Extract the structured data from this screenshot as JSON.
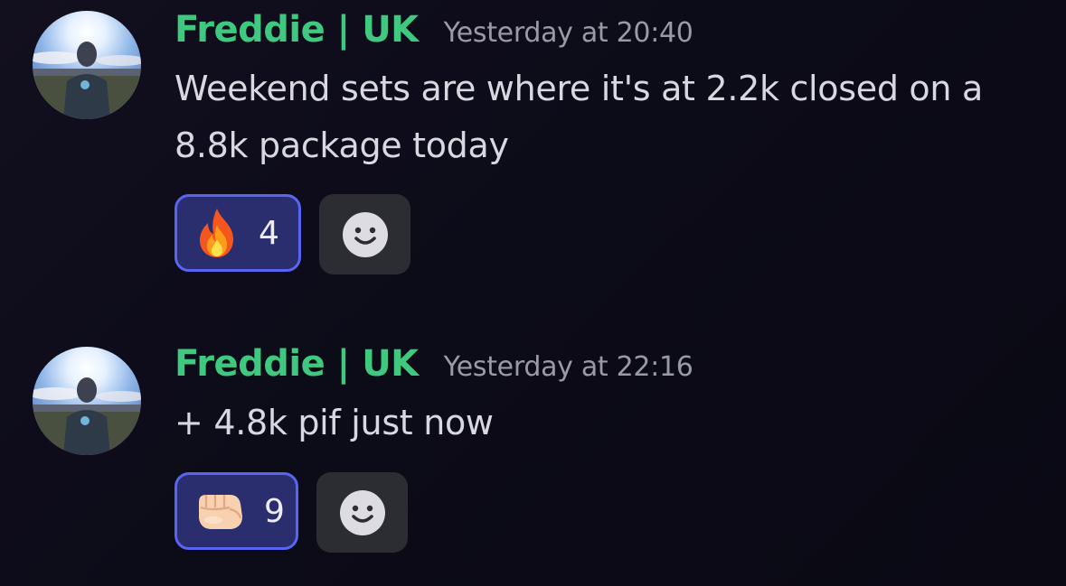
{
  "messages": [
    {
      "username": "Freddie | UK",
      "timestamp": "Yesterday at 20:40",
      "text": "Weekend sets are where it's at 2.2k closed on a 8.8k package today",
      "reaction": {
        "emoji": "fire-emoji",
        "count": "4"
      },
      "add_reaction_icon": "smiley-face-icon"
    },
    {
      "username": "Freddie | UK",
      "timestamp": "Yesterday at 22:16",
      "text": "+ 4.8k pif just now",
      "reaction": {
        "emoji": "fist-emoji",
        "count": "9"
      },
      "add_reaction_icon": "smiley-face-icon"
    }
  ],
  "colors": {
    "username": "#3fc97e",
    "timestamp": "#9a9aa6",
    "reaction_border": "#5865f2",
    "reaction_bg": "#2a2d6e",
    "add_reaction_bg": "#2c2d33",
    "background": "#0d0b1a"
  }
}
